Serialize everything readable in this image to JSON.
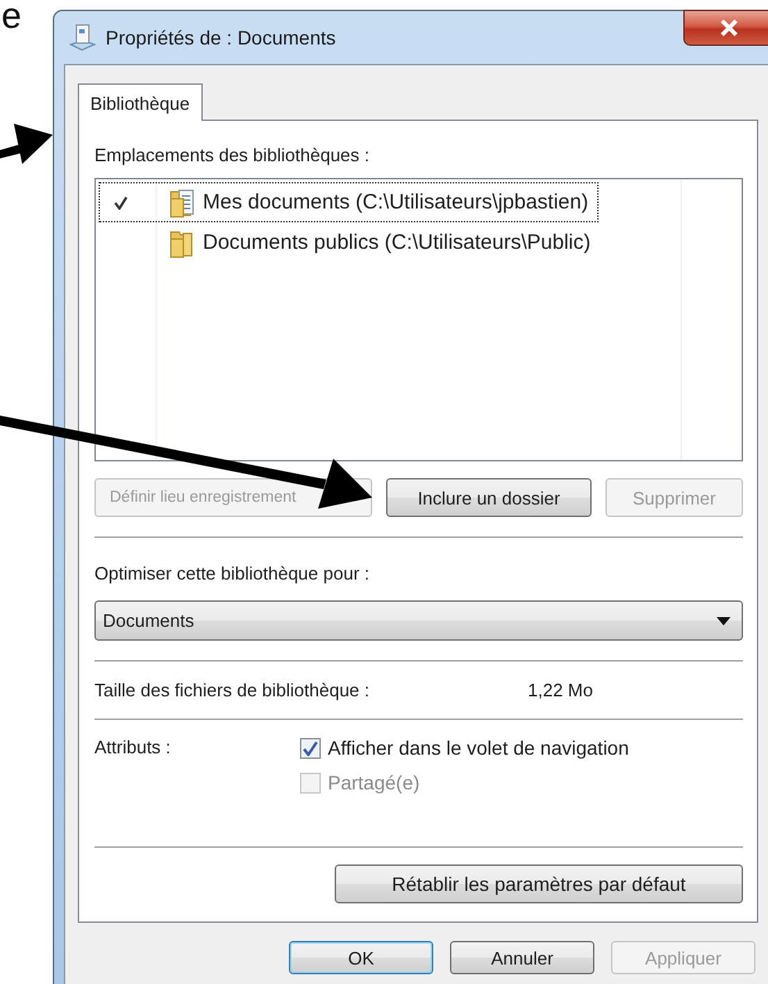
{
  "background_text": "e",
  "window": {
    "title": "Propriétés de : Documents"
  },
  "tabs": [
    {
      "label": "Bibliothèque",
      "selected": true
    }
  ],
  "locations": {
    "label": "Emplacements des bibliothèques :",
    "items": [
      {
        "name": "Mes documents (C:\\Utilisateurs\\jpbastien)",
        "kind": "documents",
        "default": true,
        "focused": true
      },
      {
        "name": "Documents publics (C:\\Utilisateurs\\Public)",
        "kind": "folder",
        "default": false,
        "focused": false
      }
    ]
  },
  "location_buttons": [
    {
      "label": "Définir lieu enregistrement",
      "disabled": true
    },
    {
      "label": "Inclure un dossier",
      "disabled": false
    },
    {
      "label": "Supprimer",
      "disabled": true
    }
  ],
  "optimize": {
    "label": "Optimiser cette bibliothèque pour :",
    "value": "Documents"
  },
  "size": {
    "label": "Taille des fichiers de bibliothèque :",
    "value": "1,22 Mo"
  },
  "attributes": {
    "label": "Attributs :",
    "options": [
      {
        "label": "Afficher dans le volet de navigation",
        "checked": true,
        "disabled": false
      },
      {
        "label": "Partagé(e)",
        "checked": false,
        "disabled": true
      }
    ]
  },
  "restore_button": {
    "label": "Rétablir les paramètres par défaut"
  },
  "buttons": [
    {
      "label": "OK",
      "default": true,
      "disabled": false
    },
    {
      "label": "Annuler",
      "default": false,
      "disabled": false
    },
    {
      "label": "Appliquer",
      "default": false,
      "disabled": true
    }
  ]
}
